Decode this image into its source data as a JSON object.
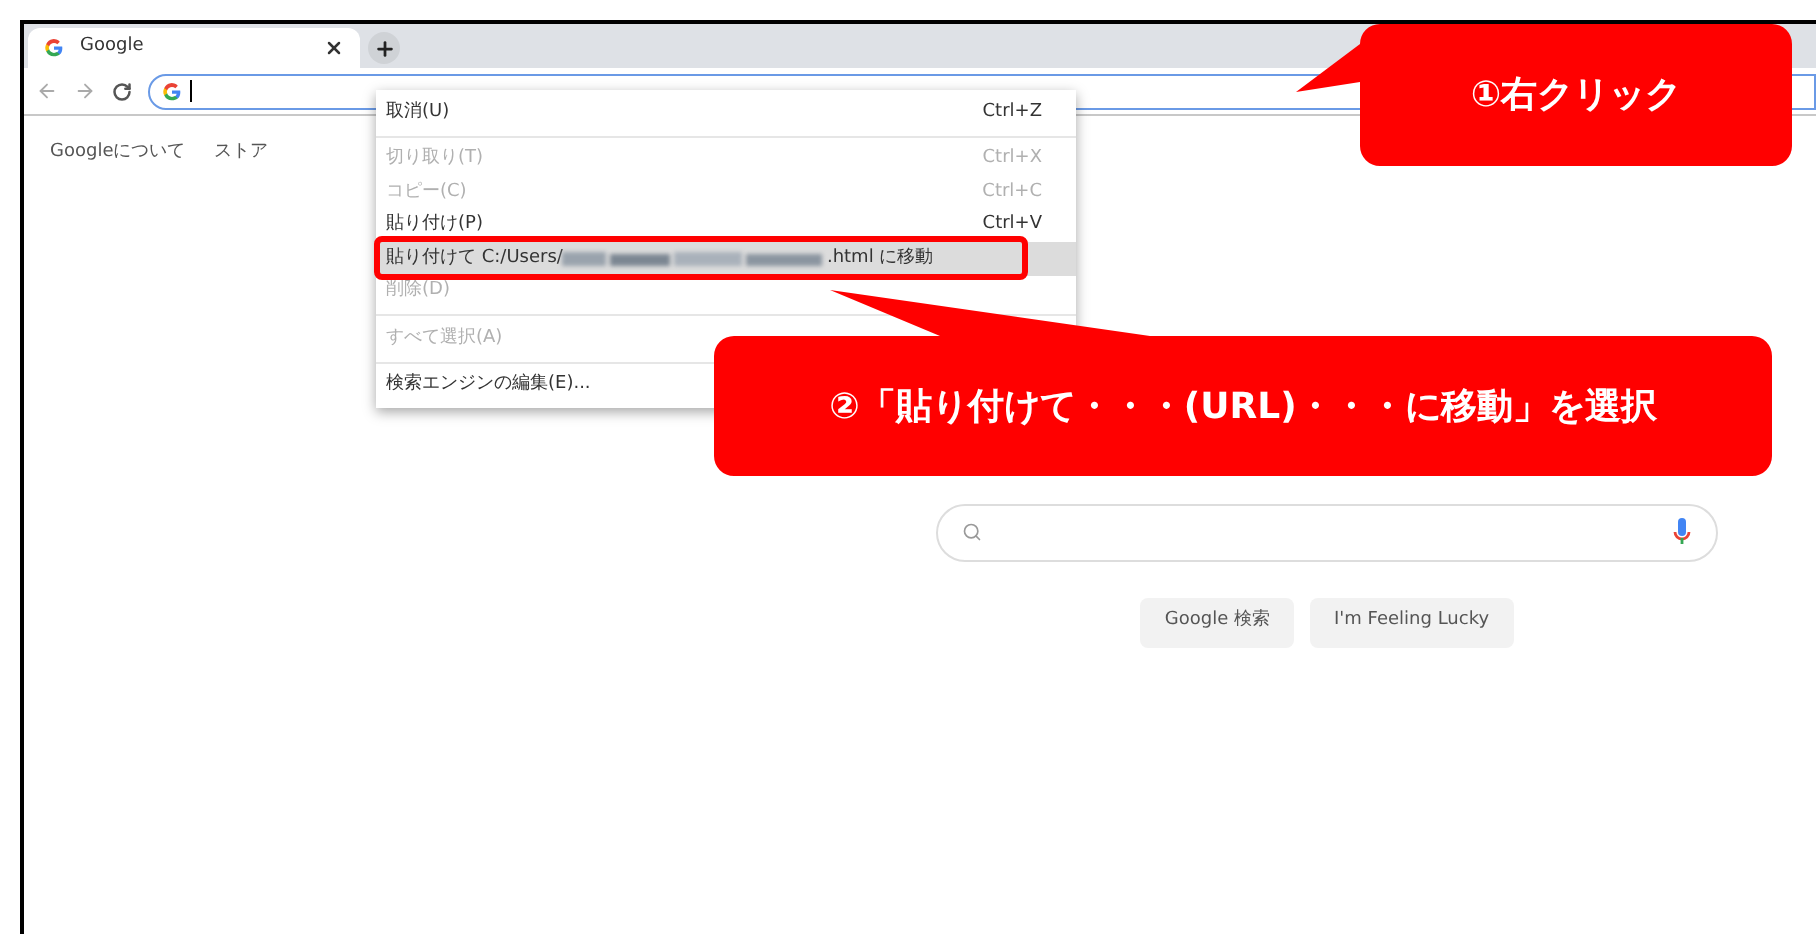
{
  "tab": {
    "title": "Google"
  },
  "nav_links": [
    "Googleについて",
    "ストア"
  ],
  "context_menu": {
    "items": [
      {
        "kind": "item",
        "label": "取消(U)",
        "shortcut": "Ctrl+Z",
        "disabled": false,
        "selected": false
      },
      {
        "kind": "separator"
      },
      {
        "kind": "item",
        "label": "切り取り(T)",
        "shortcut": "Ctrl+X",
        "disabled": true,
        "selected": false
      },
      {
        "kind": "item",
        "label": "コピー(C)",
        "shortcut": "Ctrl+C",
        "disabled": true,
        "selected": false
      },
      {
        "kind": "item",
        "label": "貼り付け(P)",
        "shortcut": "Ctrl+V",
        "disabled": false,
        "selected": false
      },
      {
        "kind": "redacted",
        "label_start": "貼り付けて C:/Users/",
        "label_end": ".html に移動",
        "disabled": false,
        "selected": true
      },
      {
        "kind": "item",
        "label": "削除(D)",
        "disabled": true,
        "selected": false
      },
      {
        "kind": "separator"
      },
      {
        "kind": "item",
        "label": "すべて選択(A)",
        "disabled": true,
        "selected": false
      },
      {
        "kind": "separator"
      },
      {
        "kind": "item",
        "label": "検索エンジンの編集(E)...",
        "disabled": false,
        "selected": false
      }
    ]
  },
  "callouts": [
    "①右クリック",
    "②「貼り付けて・・・(URL)・・・に移動」を選択"
  ],
  "buttons": [
    "Google 検索",
    "I'm Feeling Lucky"
  ]
}
